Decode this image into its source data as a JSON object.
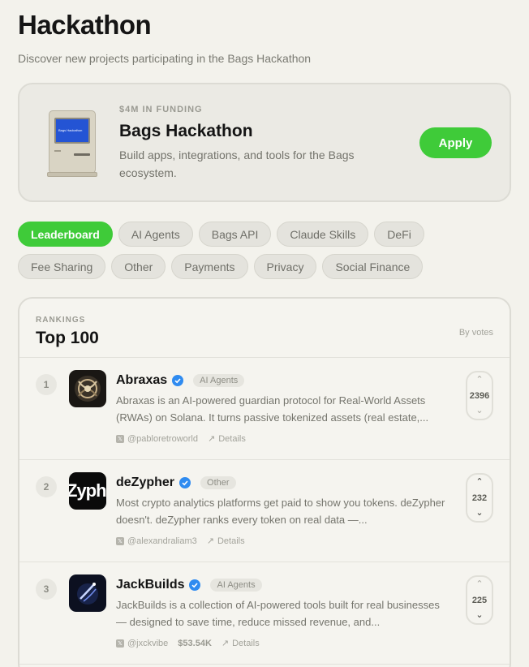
{
  "header": {
    "title": "Hackathon",
    "subtitle": "Discover new projects participating in the Bags Hackathon"
  },
  "hero": {
    "eyebrow": "$4M IN FUNDING",
    "title": "Bags Hackathon",
    "description": "Build apps, integrations, and tools for the Bags ecosystem.",
    "apply_label": "Apply",
    "screen_text": "Bags Hackathon"
  },
  "filters": {
    "row1": [
      "Leaderboard",
      "AI Agents",
      "Bags API",
      "Claude Skills",
      "DeFi"
    ],
    "row2": [
      "Fee Sharing",
      "Other",
      "Payments",
      "Privacy",
      "Social Finance"
    ],
    "active": "Leaderboard"
  },
  "rankings": {
    "eyebrow": "RANKINGS",
    "title": "Top 100",
    "sort_label": "By votes",
    "projects": [
      {
        "rank": "1",
        "name": "Abraxas",
        "tag": "AI Agents",
        "description": "Abraxas is an AI-powered guardian protocol for Real-World Assets (RWAs) on Solana. It turns passive tokenized assets (real estate,...",
        "handle": "@pabloretroworld",
        "revenue": "",
        "details": "Details",
        "votes": "2396"
      },
      {
        "rank": "2",
        "name": "deZypher",
        "tag": "Other",
        "description": "Most crypto analytics platforms get paid to show you tokens. deZypher doesn't. deZypher ranks every token on real data —...",
        "handle": "@alexandraliam3",
        "revenue": "",
        "details": "Details",
        "votes": "232",
        "avatar_text": "Zyph"
      },
      {
        "rank": "3",
        "name": "JackBuilds",
        "tag": "AI Agents",
        "description": "JackBuilds is a collection of AI-powered tools built for real businesses — designed to save time, reduce missed revenue, and...",
        "handle": "@jxckvibe",
        "revenue": "$53.54K",
        "details": "Details",
        "votes": "225"
      }
    ]
  },
  "colors": {
    "accent": "#3fcb39",
    "background": "#f3f2ec",
    "verified": "#2f8bf0"
  }
}
